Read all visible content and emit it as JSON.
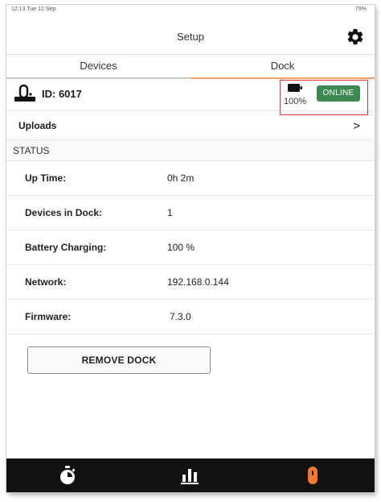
{
  "status_bar": {
    "time": "12:13   Tue 12 Sep",
    "battery": "79%"
  },
  "header": {
    "title": "Setup",
    "settings_icon": "gear-icon"
  },
  "tabs": [
    {
      "label": "Devices",
      "active": false
    },
    {
      "label": "Dock",
      "active": true
    }
  ],
  "dock": {
    "id_label": "ID: 6017",
    "icon": "dock-device-icon",
    "battery_icon": "battery-icon",
    "battery_percent": "100%",
    "connection_status": "ONLINE"
  },
  "uploads": {
    "label": "Uploads",
    "chevron": ">"
  },
  "status": {
    "header": "STATUS",
    "rows": [
      {
        "label": "Up Time:",
        "value": "0h 2m"
      },
      {
        "label": "Devices in Dock:",
        "value": "1"
      },
      {
        "label": "Battery Charging:",
        "value": "100 %"
      },
      {
        "label": "Network:",
        "value": "192.168.0.144"
      },
      {
        "label": "Firmware:",
        "value": "7.3.0"
      }
    ]
  },
  "actions": {
    "remove_dock_label": "REMOVE DOCK"
  },
  "tab_bar": {
    "items": [
      "stopwatch-icon",
      "bar-chart-icon",
      "dock-icon"
    ],
    "active_color": "#f07a2a"
  },
  "colors": {
    "online_badge": "#3c8a52",
    "dock_tab_underline": "#f0a36b",
    "highlight_box": "#e0322d"
  }
}
